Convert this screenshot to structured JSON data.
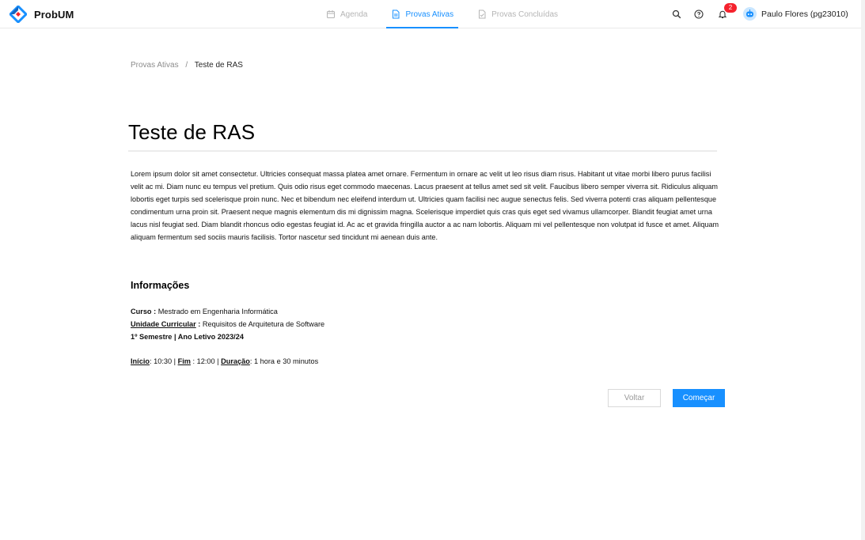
{
  "app": {
    "name": "ProbUM"
  },
  "nav": {
    "items": [
      {
        "label": "Agenda",
        "icon": "calendar-icon",
        "active": false
      },
      {
        "label": "Provas Ativas",
        "icon": "file-icon",
        "active": true
      },
      {
        "label": "Provas Concluídas",
        "icon": "file-done-icon",
        "active": false
      }
    ]
  },
  "header": {
    "notifications_count": "2",
    "user_name": "Paulo Flores (pg23010)"
  },
  "breadcrumb": {
    "parent": "Provas Ativas",
    "separator": "/",
    "current": "Teste de RAS"
  },
  "exam": {
    "title": "Teste de RAS",
    "description": "Lorem ipsum dolor sit amet consectetur. Ultricies consequat massa platea amet ornare. Fermentum in ornare ac velit ut leo risus diam risus. Habitant ut vitae morbi libero purus facilisi velit ac mi. Diam nunc eu tempus vel pretium. Quis odio risus eget commodo maecenas. Lacus praesent at tellus amet sed sit velit. Faucibus libero semper viverra sit. Ridiculus aliquam lobortis eget turpis sed scelerisque proin nunc. Nec et bibendum nec eleifend interdum ut. Ultricies quam facilisi nec augue senectus felis. Sed viverra potenti cras aliquam pellentesque condimentum urna proin sit. Praesent neque magnis elementum dis mi dignissim magna. Scelerisque imperdiet quis cras quis eget sed vivamus ullamcorper. Blandit feugiat amet urna lacus nisl feugiat sed. Diam blandit rhoncus odio egestas feugiat id. Ac ac et gravida fringilla auctor a ac nam lobortis. Aliquam mi vel pellentesque non volutpat id fusce et amet. Aliquam aliquam fermentum sed sociis mauris facilisis. Tortor nascetur sed tincidunt mi aenean duis ante.",
    "info_title": "Informações",
    "curso_label": "Curso :",
    "curso_value": "Mestrado em Engenharia Informática",
    "uc_label": "Unidade Curricular",
    "uc_colon": " :",
    "uc_value": "Requisitos de Arquitetura de Software",
    "semester": "1º Semestre | Ano Letivo 2023/24",
    "inicio_label": "Início",
    "inicio_value": ": 10:30 | ",
    "fim_label": "Fim",
    "fim_value": " : 12:00  | ",
    "duracao_label": "Duração",
    "duracao_value": ": 1 hora e 30 minutos"
  },
  "actions": {
    "back_label": "Voltar",
    "start_label": "Começar"
  },
  "colors": {
    "accent": "#1890ff",
    "badge": "#f5222d",
    "logo_blue": "#1890ff",
    "logo_red": "#f5222d"
  }
}
